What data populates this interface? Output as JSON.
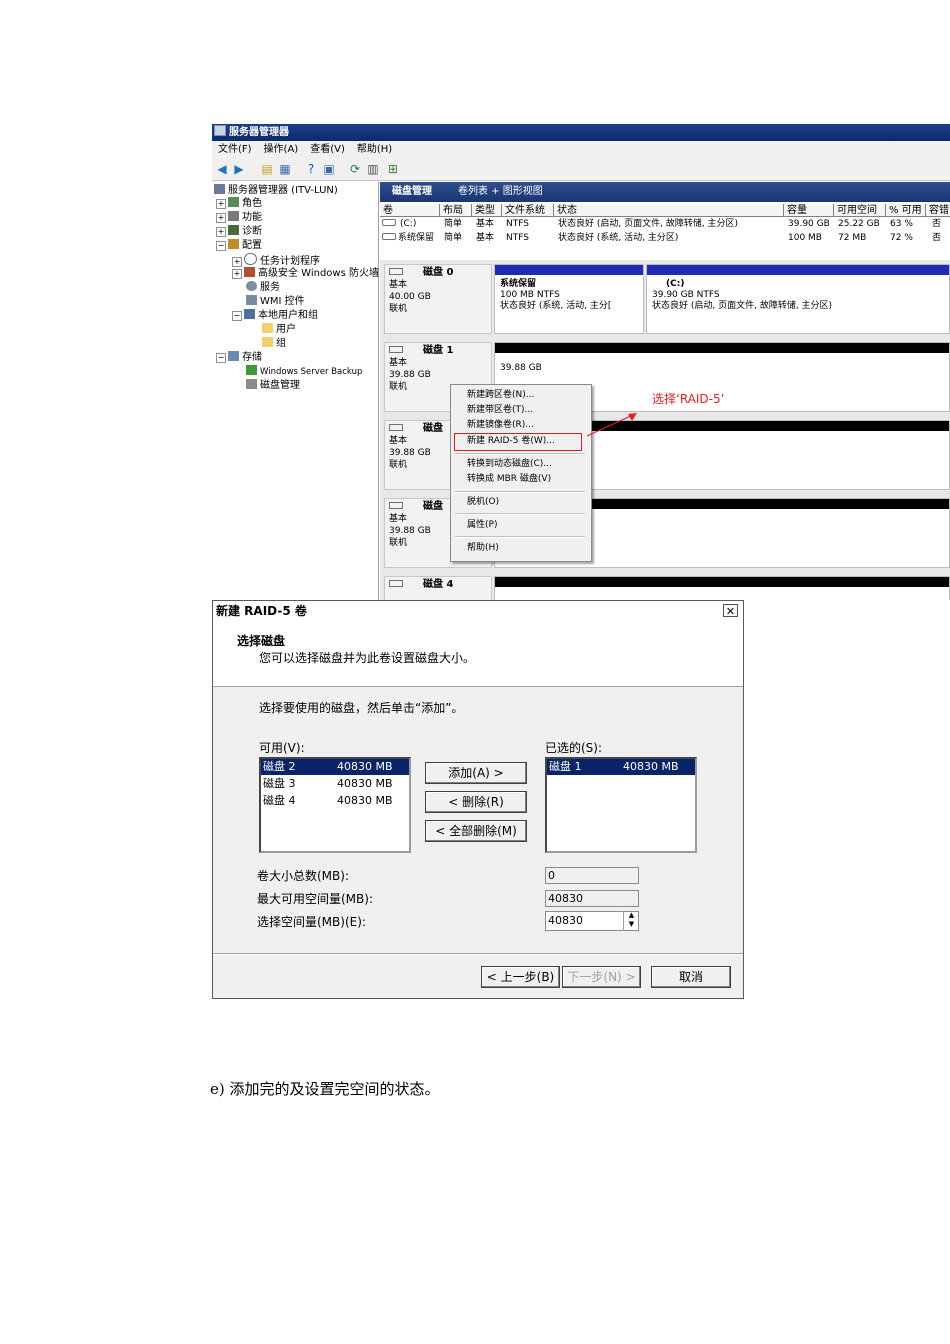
{
  "server_manager": {
    "title": "服务器管理器",
    "menu": [
      "文件(F)",
      "操作(A)",
      "查看(V)",
      "帮助(H)"
    ],
    "tree": {
      "root": "服务器管理器 (ITV-LUN)",
      "roles": "角色",
      "features": "功能",
      "diagnostics": "诊断",
      "configuration": "配置",
      "task_scheduler": "任务计划程序",
      "firewall": "高级安全 Windows 防火墙",
      "services": "服务",
      "wmi": "WMI 控件",
      "local_users": "本地用户和组",
      "users": "用户",
      "groups": "组",
      "storage": "存储",
      "backup": "Windows Server Backup",
      "disk_mgmt": "磁盘管理"
    },
    "main_header": {
      "title": "磁盘管理",
      "view": "卷列表 + 图形视图"
    },
    "volume_columns": [
      "卷",
      "布局",
      "类型",
      "文件系统",
      "状态",
      "容量",
      "可用空间",
      "% 可用",
      "容错"
    ],
    "volumes": [
      {
        "name": "(C:)",
        "layout": "简单",
        "type": "基本",
        "fs": "NTFS",
        "status": "状态良好 (启动, 页面文件, 故障转储, 主分区)",
        "capacity": "39.90 GB",
        "free": "25.22 GB",
        "pct": "63 %",
        "fault": "否"
      },
      {
        "name": "系统保留",
        "layout": "简单",
        "type": "基本",
        "fs": "NTFS",
        "status": "状态良好 (系统, 活动, 主分区)",
        "capacity": "100 MB",
        "free": "72 MB",
        "pct": "72 %",
        "fault": "否"
      }
    ],
    "disks": [
      {
        "name": "磁盘 0",
        "type": "基本",
        "size": "40.00 GB",
        "state": "联机"
      },
      {
        "name": "磁盘 1",
        "type": "基本",
        "size": "39.88 GB",
        "state": "联机"
      },
      {
        "name": "磁盘",
        "type": "基本",
        "size": "39.88 GB",
        "state": "联机"
      },
      {
        "name": "磁盘",
        "type": "基本",
        "size": "39.88 GB",
        "state": "联机"
      },
      {
        "name": "磁盘 4",
        "type": "基本",
        "size": "",
        "state": ""
      }
    ],
    "partitions": {
      "sys_reserved": {
        "name": "系统保留",
        "size": "100 MB NTFS",
        "status": "状态良好 (系统, 活动, 主分["
      },
      "c_drive": {
        "name": "(C:)",
        "size": "39.90 GB NTFS",
        "status": "状态良好 (启动, 页面文件, 故障转储, 主分区)"
      },
      "disk1_unalloc": {
        "size": "39.88 GB"
      }
    },
    "context_menu": [
      "新建跨区卷(N)...",
      "新建带区卷(T)...",
      "新建镜像卷(R)...",
      "新建 RAID-5 卷(W)...",
      "转换到动态磁盘(C)...",
      "转换成 MBR 磁盘(V)",
      "脱机(O)",
      "属性(P)",
      "帮助(H)"
    ],
    "annotation": "选择‘RAID-5’"
  },
  "dialog": {
    "title": "新建 RAID-5 卷",
    "heading": "选择磁盘",
    "subheading": "您可以选择磁盘并为此卷设置磁盘大小。",
    "instruction": "选择要使用的磁盘，然后单击“添加”。",
    "available_label": "可用(V):",
    "selected_label": "已选的(S):",
    "available": [
      {
        "disk": "磁盘 2",
        "size": "40830 MB"
      },
      {
        "disk": "磁盘 3",
        "size": "40830 MB"
      },
      {
        "disk": "磁盘 4",
        "size": "40830 MB"
      }
    ],
    "selected": [
      {
        "disk": "磁盘 1",
        "size": "40830 MB"
      }
    ],
    "add_button": "添加(A) >",
    "remove_button": "< 删除(R)",
    "remove_all_button": "< 全部删除(M)",
    "total_label": "卷大小总数(MB):",
    "total_value": "0",
    "max_label": "最大可用空间量(MB):",
    "max_value": "40830",
    "select_label": "选择空间量(MB)(E):",
    "select_value": "40830",
    "back_button": "< 上一步(B)",
    "next_button": "下一步(N) >",
    "cancel_button": "取消"
  },
  "caption": "e)  添加完的及设置完空间的状态。",
  "colors": {
    "title_bar": "#0c2a6e",
    "selection": "#0a246a",
    "annotation": "#e02020",
    "partition_bar": "#1f2bb0"
  }
}
